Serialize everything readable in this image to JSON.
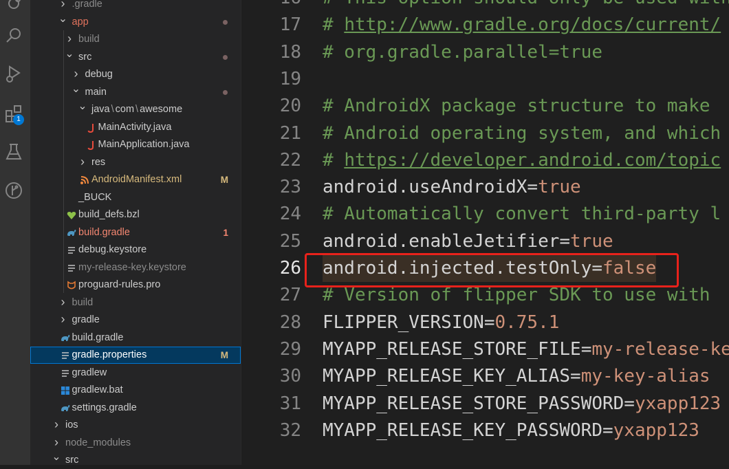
{
  "activity_bar": {
    "icons": [
      "source-control-icon",
      "search-icon",
      "run-debug-icon",
      "extensions-icon",
      "testing-icon",
      "git-graph-icon"
    ],
    "extensions_badge": "1",
    "accent": "#0078d4"
  },
  "explorer": {
    "items": [
      {
        "label": ".gradle",
        "kind": "folder",
        "expanded": false,
        "color": "#8b8b8b",
        "status": "",
        "dot": false
      },
      {
        "label": "app",
        "kind": "folder",
        "expanded": true,
        "color": "#e2735d",
        "status": "",
        "dot": true
      },
      {
        "label": "build",
        "kind": "folder",
        "expanded": false,
        "color": "#8b8b8b",
        "status": "",
        "dot": false
      },
      {
        "label": "src",
        "kind": "folder",
        "expanded": true,
        "color": "#cccccc",
        "status": "",
        "dot": true
      },
      {
        "label": "debug",
        "kind": "folder",
        "expanded": false,
        "color": "#cccccc",
        "status": "",
        "dot": false
      },
      {
        "label": "main",
        "kind": "folder",
        "expanded": true,
        "color": "#cccccc",
        "status": "",
        "dot": true
      },
      {
        "label_parts": [
          "java",
          "com",
          "awesome"
        ],
        "kind": "folder",
        "expanded": true,
        "color": "#cccccc",
        "status": "",
        "dot": false
      },
      {
        "label": "MainActivity.java",
        "kind": "java",
        "color": "#cccccc",
        "status": "",
        "dot": false
      },
      {
        "label": "MainApplication.java",
        "kind": "java",
        "color": "#cccccc",
        "status": "",
        "dot": false
      },
      {
        "label": "res",
        "kind": "folder",
        "expanded": false,
        "color": "#cccccc",
        "status": "",
        "dot": false
      },
      {
        "label": "AndroidManifest.xml",
        "kind": "xml",
        "color": "#d7ba7d",
        "status": "M",
        "status_color": "#d7ba7d",
        "dot": false
      },
      {
        "label": "_BUCK",
        "kind": "plain",
        "color": "#cccccc",
        "status": "",
        "dot": false
      },
      {
        "label": "build_defs.bzl",
        "kind": "bzl",
        "color": "#cccccc",
        "status": "",
        "dot": false
      },
      {
        "label": "build.gradle",
        "kind": "gradle",
        "color": "#f48771",
        "status": "1",
        "status_color": "#f48771",
        "dot": false
      },
      {
        "label": "debug.keystore",
        "kind": "plain",
        "color": "#cccccc",
        "status": "",
        "dot": false
      },
      {
        "label": "my-release-key.keystore",
        "kind": "plain",
        "color": "#8b8b8b",
        "status": "",
        "dot": false
      },
      {
        "label": "proguard-rules.pro",
        "kind": "pro",
        "color": "#cccccc",
        "status": "",
        "dot": false
      },
      {
        "label": "build",
        "kind": "folder",
        "expanded": false,
        "color": "#8b8b8b",
        "status": "",
        "dot": false
      },
      {
        "label": "gradle",
        "kind": "folder",
        "expanded": false,
        "color": "#cccccc",
        "status": "",
        "dot": false
      },
      {
        "label": "build.gradle",
        "kind": "gradle",
        "color": "#cccccc",
        "status": "",
        "dot": false
      },
      {
        "label": "gradle.properties",
        "kind": "plain",
        "color": "#ffffff",
        "status": "M",
        "status_color": "#d7ba7d",
        "dot": false,
        "selected": true
      },
      {
        "label": "gradlew",
        "kind": "plain",
        "color": "#cccccc",
        "status": "",
        "dot": false
      },
      {
        "label": "gradlew.bat",
        "kind": "windows",
        "color": "#cccccc",
        "status": "",
        "dot": false
      },
      {
        "label": "settings.gradle",
        "kind": "gradle",
        "color": "#cccccc",
        "status": "",
        "dot": false
      },
      {
        "label": "ios",
        "kind": "folder",
        "expanded": false,
        "color": "#cccccc",
        "status": "",
        "dot": false
      },
      {
        "label": "node_modules",
        "kind": "folder",
        "expanded": false,
        "color": "#8b8b8b",
        "status": "",
        "dot": false
      },
      {
        "label": "src",
        "kind": "folder",
        "expanded": true,
        "color": "#cccccc",
        "status": "",
        "dot": false
      }
    ]
  },
  "editor": {
    "active_line": "26",
    "lines": [
      {
        "n": "16",
        "tokens": [
          {
            "t": "# This option should only be used with",
            "c": "comment"
          }
        ]
      },
      {
        "n": "17",
        "tokens": [
          {
            "t": "# ",
            "c": "comment"
          },
          {
            "t": "http://www.gradle.org/docs/current/",
            "c": "link"
          }
        ]
      },
      {
        "n": "18",
        "tokens": [
          {
            "t": "# org.gradle.parallel=true",
            "c": "comment"
          }
        ]
      },
      {
        "n": "19",
        "tokens": []
      },
      {
        "n": "20",
        "tokens": [
          {
            "t": "# AndroidX package structure to make",
            "c": "comment"
          }
        ]
      },
      {
        "n": "21",
        "tokens": [
          {
            "t": "# Android operating system, and which",
            "c": "comment"
          }
        ]
      },
      {
        "n": "22",
        "tokens": [
          {
            "t": "# ",
            "c": "comment"
          },
          {
            "t": "https://developer.android.com/topic",
            "c": "link"
          }
        ]
      },
      {
        "n": "23",
        "tokens": [
          {
            "t": "android.useAndroidX",
            "c": "key"
          },
          {
            "t": "=",
            "c": "plain"
          },
          {
            "t": "true",
            "c": "val"
          }
        ]
      },
      {
        "n": "24",
        "tokens": [
          {
            "t": "# Automatically convert third-party l",
            "c": "comment"
          }
        ]
      },
      {
        "n": "25",
        "tokens": [
          {
            "t": "android.enableJetifier",
            "c": "key"
          },
          {
            "t": "=",
            "c": "plain"
          },
          {
            "t": "true",
            "c": "val"
          }
        ]
      },
      {
        "n": "26",
        "tokens": [
          {
            "t": "android.injected.testOnly",
            "c": "key"
          },
          {
            "t": "=",
            "c": "plain"
          },
          {
            "t": "false",
            "c": "val"
          }
        ],
        "highlight": true
      },
      {
        "n": "27",
        "tokens": [
          {
            "t": "# Version of flipper SDK to use with",
            "c": "comment"
          }
        ]
      },
      {
        "n": "28",
        "tokens": [
          {
            "t": "FLIPPER_VERSION",
            "c": "key"
          },
          {
            "t": "=",
            "c": "plain"
          },
          {
            "t": "0.75.1",
            "c": "val"
          }
        ]
      },
      {
        "n": "29",
        "tokens": [
          {
            "t": "MYAPP_RELEASE_STORE_FILE",
            "c": "key"
          },
          {
            "t": "=",
            "c": "plain"
          },
          {
            "t": "my-release-key",
            "c": "val"
          }
        ]
      },
      {
        "n": "30",
        "tokens": [
          {
            "t": "MYAPP_RELEASE_KEY_ALIAS",
            "c": "key"
          },
          {
            "t": "=",
            "c": "plain"
          },
          {
            "t": "my-key-alias",
            "c": "val"
          }
        ]
      },
      {
        "n": "31",
        "tokens": [
          {
            "t": "MYAPP_RELEASE_STORE_PASSWORD",
            "c": "key"
          },
          {
            "t": "=",
            "c": "plain"
          },
          {
            "t": "yxapp123",
            "c": "val"
          }
        ]
      },
      {
        "n": "32",
        "tokens": [
          {
            "t": "MYAPP_RELEASE_KEY_PASSWORD",
            "c": "key"
          },
          {
            "t": "=",
            "c": "plain"
          },
          {
            "t": "yxapp123",
            "c": "val"
          }
        ]
      }
    ],
    "annotation_color": "#e8221b"
  }
}
